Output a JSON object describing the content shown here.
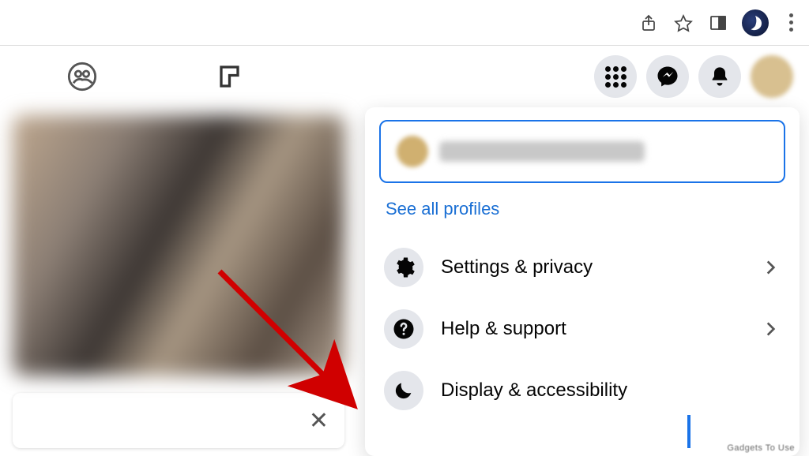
{
  "browser": {
    "icons": {
      "share": "share-icon",
      "star": "star-icon",
      "panel": "side-panel-icon",
      "profile": "browser-profile-icon",
      "menu": "kebab-menu-icon"
    }
  },
  "fb_nav": {
    "tabs": {
      "groups": "groups-tab",
      "gaming": "gaming-tab"
    },
    "buttons": {
      "menu": "menu-grid-icon",
      "messenger": "messenger-icon",
      "notifications": "bell-icon",
      "account": "account-avatar"
    }
  },
  "dropdown": {
    "see_all_label": "See all profiles",
    "items": [
      {
        "icon": "gear-icon",
        "label": "Settings & privacy",
        "has_chevron": true
      },
      {
        "icon": "help-icon",
        "label": "Help & support",
        "has_chevron": true
      },
      {
        "icon": "moon-icon",
        "label": "Display & accessibility",
        "has_chevron": false
      }
    ]
  },
  "watermark": "Gadgets To Use",
  "annotation": {
    "arrow_color": "#d00000",
    "arrow_points_to": "settings-privacy"
  }
}
